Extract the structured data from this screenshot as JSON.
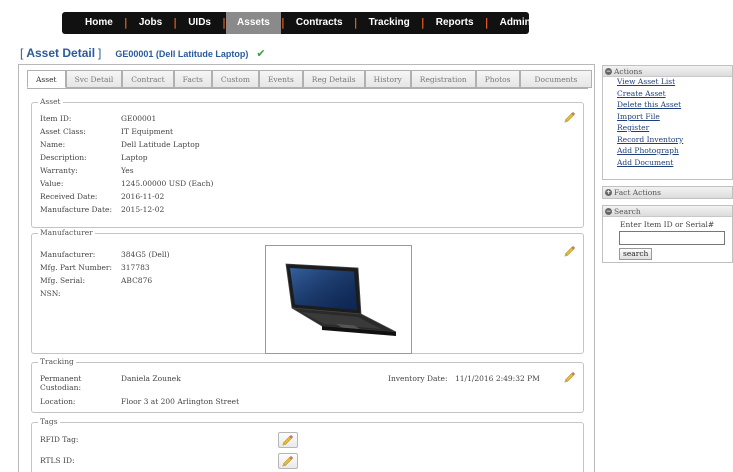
{
  "nav": {
    "items": [
      {
        "label": "Home",
        "active": false
      },
      {
        "label": "Jobs",
        "active": false
      },
      {
        "label": "UIDs",
        "active": false
      },
      {
        "label": "Assets",
        "active": true
      },
      {
        "label": "Contracts",
        "active": false
      },
      {
        "label": "Tracking",
        "active": false
      },
      {
        "label": "Reports",
        "active": false
      },
      {
        "label": "Admin",
        "active": false
      }
    ],
    "separator_color": "#e25b1f"
  },
  "header": {
    "bracket_open": "[",
    "title": "Asset Detail",
    "bracket_close": "]",
    "subtitle": "GE00001 (Dell Latitude Laptop)",
    "check_icon": "check-icon"
  },
  "tabs": [
    {
      "label": "Asset",
      "active": true
    },
    {
      "label": "Svc Detail",
      "active": false
    },
    {
      "label": "Contract",
      "active": false
    },
    {
      "label": "Facts",
      "active": false
    },
    {
      "label": "Custom",
      "active": false
    },
    {
      "label": "Events",
      "active": false
    },
    {
      "label": "Reg Details",
      "active": false
    },
    {
      "label": "History",
      "active": false
    },
    {
      "label": "Registration",
      "active": false
    },
    {
      "label": "Photos",
      "active": false
    },
    {
      "label": "Documents",
      "active": false
    }
  ],
  "asset": {
    "legend": "Asset",
    "fields": [
      {
        "label": "Item ID:",
        "value": "GE00001"
      },
      {
        "label": "Asset Class:",
        "value": "IT Equipment"
      },
      {
        "label": "Name:",
        "value": "Dell Latitude Laptop"
      },
      {
        "label": "Description:",
        "value": "Laptop"
      },
      {
        "label": "Warranty:",
        "value": "Yes"
      },
      {
        "label": "Value:",
        "value": "1245.00000 USD (Each)"
      },
      {
        "label": "Received Date:",
        "value": "2016-11-02"
      },
      {
        "label": "Manufacture Date:",
        "value": "2015-12-02"
      }
    ]
  },
  "manufacturer": {
    "legend": "Manufacturer",
    "fields": [
      {
        "label": "Manufacturer:",
        "value": "384G5 (Dell)"
      },
      {
        "label": "Mfg. Part Number:",
        "value": "317783"
      },
      {
        "label": "Mfg. Serial:",
        "value": "ABC876"
      },
      {
        "label": "NSN:",
        "value": ""
      }
    ]
  },
  "tracking": {
    "legend": "Tracking",
    "custodian_label_1": "Permanent",
    "custodian_label_2": "Custodian:",
    "custodian_value": "Daniela Zounek",
    "location_label": "Location:",
    "location_value": "Floor 3 at 200 Arlington Street",
    "inventory_label": "Inventory Date:",
    "inventory_value": "11/1/2016 2:49:32 PM"
  },
  "tags": {
    "legend": "Tags",
    "rfid_label": "RFID Tag:",
    "rtls_label": "RTLS ID:"
  },
  "sidebar": {
    "actions": {
      "title": "Actions",
      "links": [
        "View Asset List",
        "Create Asset",
        "Delete this Asset",
        "Import File",
        "Register",
        "Record Inventory",
        "Add Photograph",
        "Add Document"
      ]
    },
    "fact_actions": {
      "title": "Fact Actions"
    },
    "search": {
      "title": "Search",
      "label": "Enter Item ID or Serial#",
      "input_value": "",
      "button": "search"
    }
  },
  "colors": {
    "title_blue": "#2a5b9c",
    "link_blue": "#1f3f7a",
    "nav_active": "#8a8a8a",
    "pencil": "#e6b422"
  }
}
